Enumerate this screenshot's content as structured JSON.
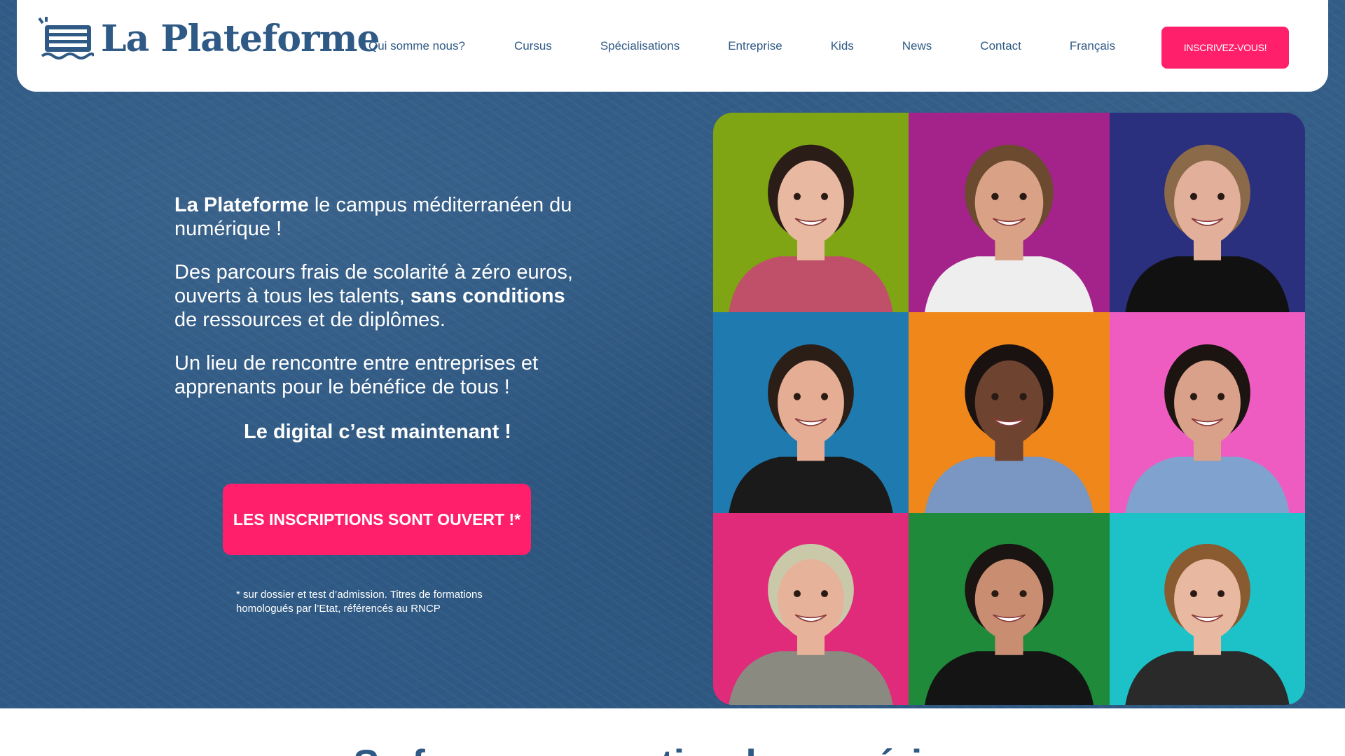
{
  "header": {
    "brand": "La Plateforme",
    "nav": [
      {
        "label": "Qui somme nous?"
      },
      {
        "label": "Cursus"
      },
      {
        "label": "Spécialisations"
      },
      {
        "label": "Entreprise"
      },
      {
        "label": "Kids"
      },
      {
        "label": "News"
      },
      {
        "label": "Contact"
      },
      {
        "label": "Français"
      }
    ],
    "cta": "INSCRIVEZ-VOUS!"
  },
  "hero": {
    "intro_bold": "La Plateforme",
    "intro_rest": " le campus méditerranéen du numérique !",
    "para2_a": "Des parcours frais de scolarité à zéro euros, ouverts à tous les talents, ",
    "para2_bold": "sans conditions",
    "para2_b": " de ressources et de diplômes.",
    "para3": "Un lieu de rencontre entre entreprises et apprenants pour le bénéfice de tous !",
    "tagline": "Le digital c’est maintenant !",
    "cta": "LES INSCRIPTIONS SONT OUVERT !*",
    "footnote": "* sur dossier et test d’admission. Titres de formations homologués par l’Etat, référencés au RNCP"
  },
  "photos": [
    {
      "bg": "#7fa414",
      "shirt": "#c0506a",
      "hair": "#2a1c17",
      "skin": "#e8b8a0"
    },
    {
      "bg": "#a3238a",
      "shirt": "#eeeeee",
      "hair": "#6b4a30",
      "skin": "#d9a287"
    },
    {
      "bg": "#2a2f7e",
      "shirt": "#111111",
      "hair": "#8a6a48",
      "skin": "#e2b09a"
    },
    {
      "bg": "#1f7ab0",
      "shirt": "#1a1a1a",
      "hair": "#2a1e16",
      "skin": "#e4ad94"
    },
    {
      "bg": "#f0871a",
      "shirt": "#7a96c2",
      "hair": "#1a1210",
      "skin": "#6e4330"
    },
    {
      "bg": "#ee5cc2",
      "shirt": "#7fa2cf",
      "hair": "#1c1410",
      "skin": "#d9a08a"
    },
    {
      "bg": "#e02a7a",
      "shirt": "#8a8a80",
      "hair": "#c9c8a8",
      "skin": "#e6b29a"
    },
    {
      "bg": "#1f8a3a",
      "shirt": "#141414",
      "hair": "#1a1412",
      "skin": "#c98e72"
    },
    {
      "bg": "#1cc2c8",
      "shirt": "#2a2a2a",
      "hair": "#8a5a30",
      "skin": "#e8b8a0"
    }
  ],
  "section": {
    "title": "Se former au metier du numérique"
  }
}
